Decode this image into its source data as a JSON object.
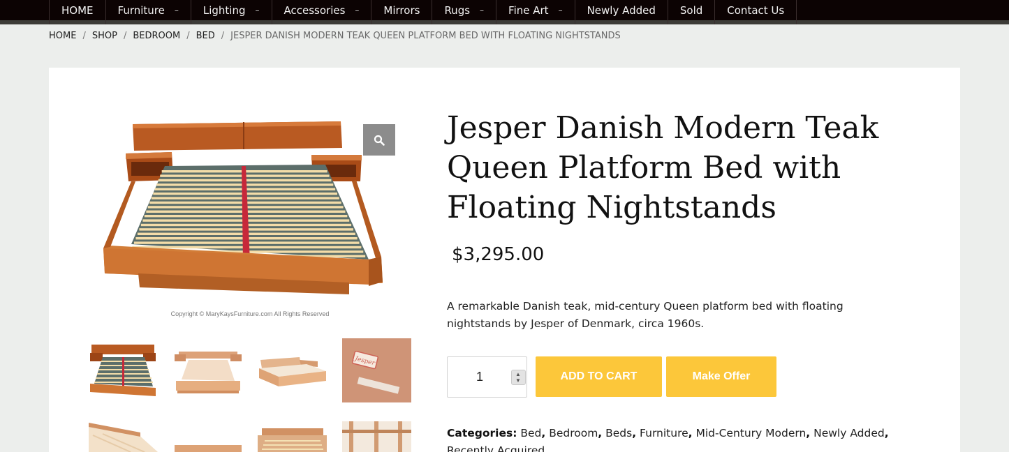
{
  "nav": {
    "items": [
      {
        "label": "HOME",
        "has_submenu": false
      },
      {
        "label": "Furniture",
        "has_submenu": true
      },
      {
        "label": "Lighting",
        "has_submenu": true
      },
      {
        "label": "Accessories",
        "has_submenu": true
      },
      {
        "label": "Mirrors",
        "has_submenu": false
      },
      {
        "label": "Rugs",
        "has_submenu": true
      },
      {
        "label": "Fine Art",
        "has_submenu": true
      },
      {
        "label": "Newly Added",
        "has_submenu": false
      },
      {
        "label": "Sold",
        "has_submenu": false
      },
      {
        "label": "Contact Us",
        "has_submenu": false
      }
    ],
    "submenu_marker": "–"
  },
  "breadcrumb": {
    "items": [
      "HOME",
      "SHOP",
      "BEDROOM",
      "BED"
    ],
    "current": "JESPER DANISH MODERN TEAK QUEEN PLATFORM BED WITH FLOATING NIGHTSTANDS",
    "separator": "/"
  },
  "product": {
    "title": "Jesper Danish Modern Teak Queen Platform Bed with Floating Nightstands",
    "price": "$3,295.00",
    "description": "A remarkable Danish teak, mid-century Queen platform bed with floating nightstands by Jesper of Denmark, circa 1960s.",
    "image_copyright": "Copyright © MaryKaysFurniture.com All Rights Reserved",
    "thumb_stamp": "Jesper"
  },
  "purchase": {
    "quantity": "1",
    "add_to_cart": "ADD TO CART",
    "make_offer": "Make Offer"
  },
  "categories": {
    "label": "Categories:",
    "items": [
      "Bed",
      "Bedroom",
      "Beds",
      "Furniture",
      "Mid-Century Modern",
      "Newly Added",
      "Recently Acquired"
    ]
  },
  "colors": {
    "nav_bg": "#0c0303",
    "button_yellow": "#fcc73a",
    "teak": "#c8682a",
    "slat": "#f3dca8",
    "center_rail": "#c7283a"
  },
  "icons": {
    "zoom": "search-icon",
    "spinner": "stepper-arrows-icon"
  }
}
